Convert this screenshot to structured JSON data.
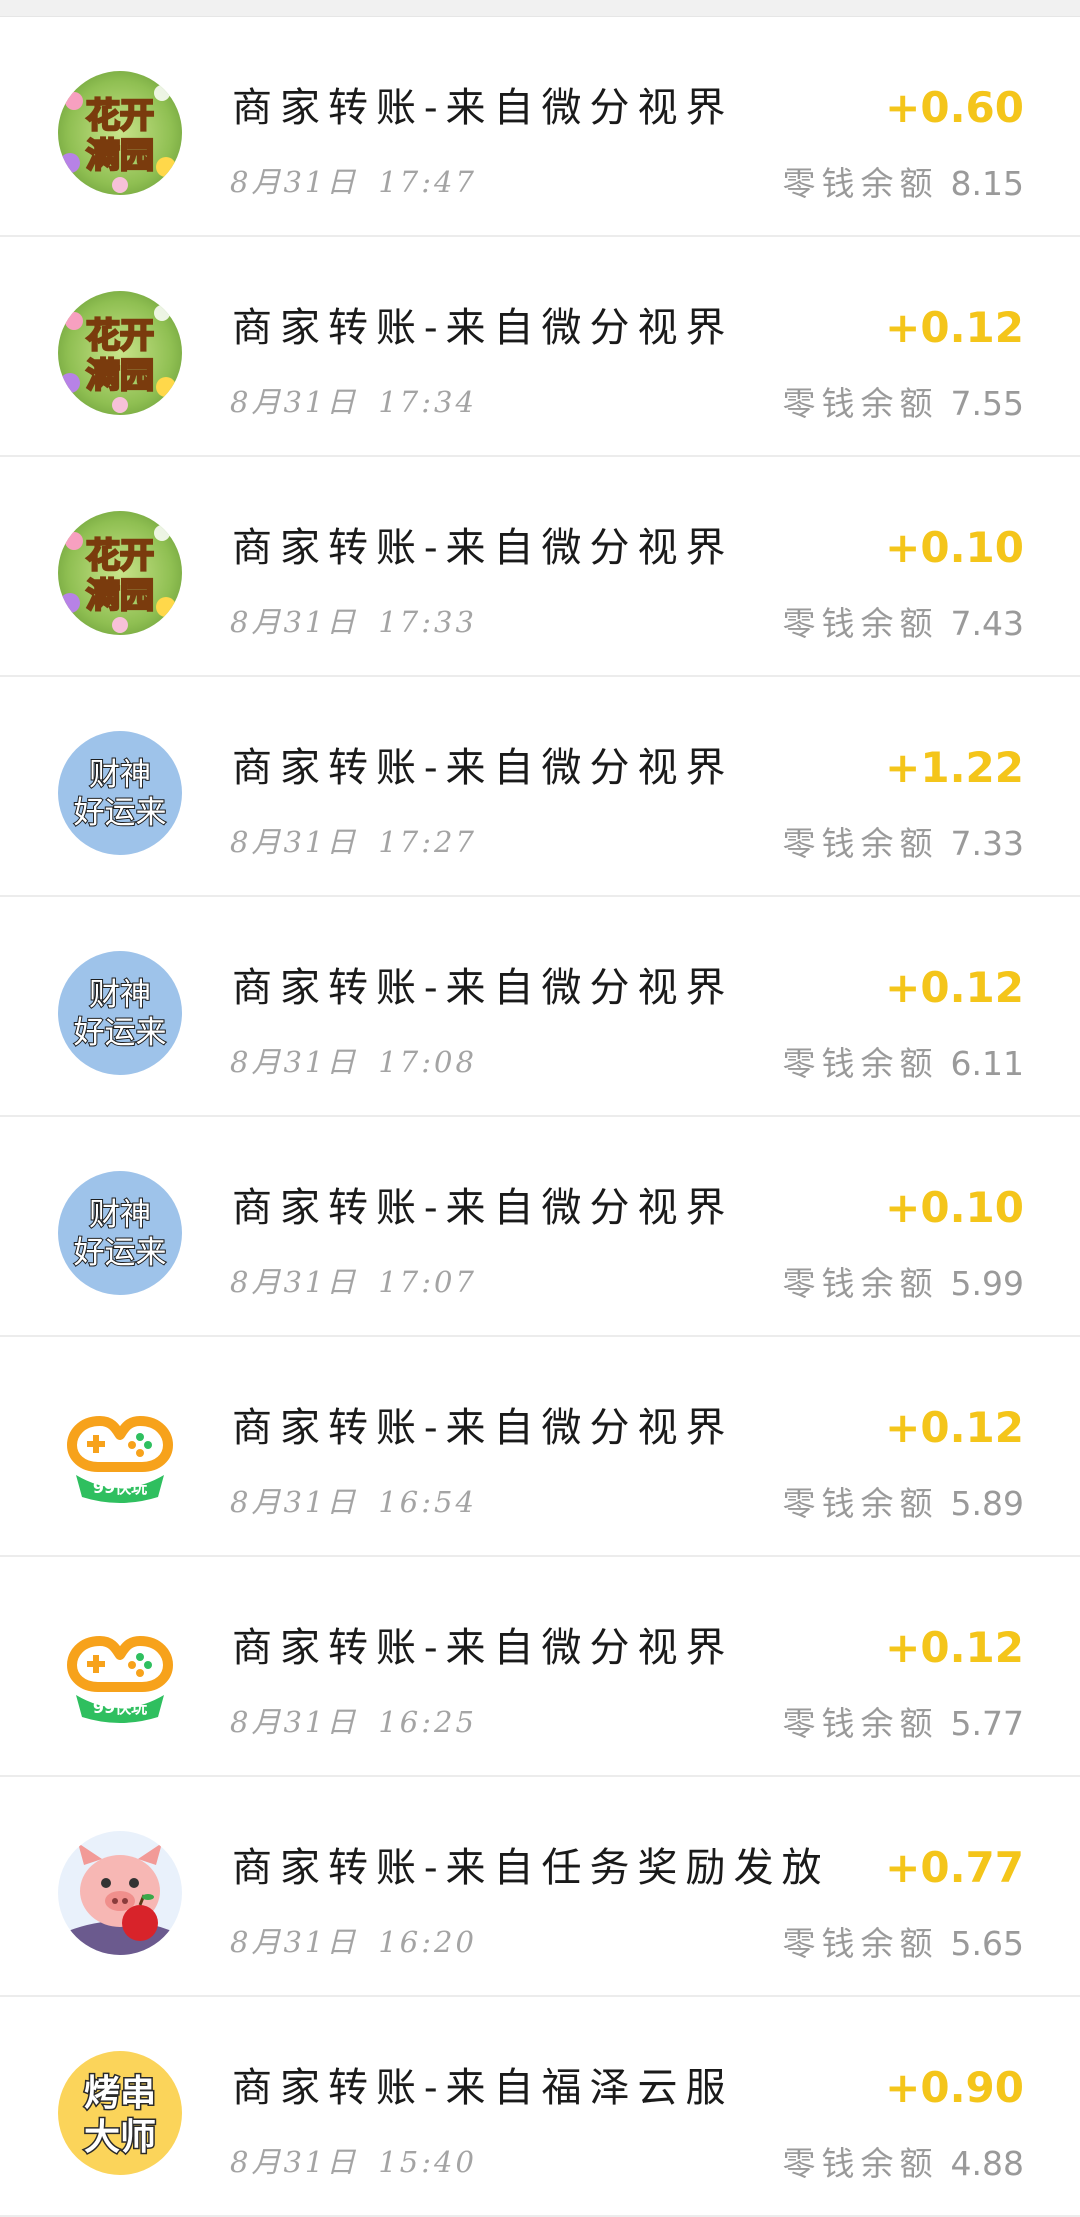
{
  "transactions": [
    {
      "icon": "huakai-manyuan-game-icon",
      "title": "商家转账-来自微分视界",
      "date": "8月31日",
      "time": "17:47",
      "amount": "+0.60",
      "balance_label": "零钱余额",
      "balance": "8.15"
    },
    {
      "icon": "huakai-manyuan-game-icon",
      "title": "商家转账-来自微分视界",
      "date": "8月31日",
      "time": "17:34",
      "amount": "+0.12",
      "balance_label": "零钱余额",
      "balance": "7.55"
    },
    {
      "icon": "huakai-manyuan-game-icon",
      "title": "商家转账-来自微分视界",
      "date": "8月31日",
      "time": "17:33",
      "amount": "+0.10",
      "balance_label": "零钱余额",
      "balance": "7.43"
    },
    {
      "icon": "caishen-haoyunlai-icon",
      "title": "商家转账-来自微分视界",
      "date": "8月31日",
      "time": "17:27",
      "amount": "+1.22",
      "balance_label": "零钱余额",
      "balance": "7.33"
    },
    {
      "icon": "caishen-haoyunlai-icon",
      "title": "商家转账-来自微分视界",
      "date": "8月31日",
      "time": "17:08",
      "amount": "+0.12",
      "balance_label": "零钱余额",
      "balance": "6.11"
    },
    {
      "icon": "caishen-haoyunlai-icon",
      "title": "商家转账-来自微分视界",
      "date": "8月31日",
      "time": "17:07",
      "amount": "+0.10",
      "balance_label": "零钱余额",
      "balance": "5.99"
    },
    {
      "icon": "99-kuaiwan-gamepad-icon",
      "title": "商家转账-来自微分视界",
      "date": "8月31日",
      "time": "16:54",
      "amount": "+0.12",
      "balance_label": "零钱余额",
      "balance": "5.89"
    },
    {
      "icon": "99-kuaiwan-gamepad-icon",
      "title": "商家转账-来自微分视界",
      "date": "8月31日",
      "time": "16:25",
      "amount": "+0.12",
      "balance_label": "零钱余额",
      "balance": "5.77"
    },
    {
      "icon": "pig-apple-icon",
      "title": "商家转账-来自任务奖励发放",
      "date": "8月31日",
      "time": "16:20",
      "amount": "+0.77",
      "balance_label": "零钱余额",
      "balance": "5.65"
    },
    {
      "icon": "kaochuan-dashi-icon",
      "title": "商家转账-来自福泽云服",
      "date": "8月31日",
      "time": "15:40",
      "amount": "+0.90",
      "balance_label": "零钱余额",
      "balance": "4.88"
    }
  ],
  "icon_text": {
    "huakai_line1": "花开",
    "huakai_line2": "满园",
    "caishen_line1": "财神",
    "caishen_line2": "好运来",
    "kuaiwan_label": "99快玩",
    "kaochuan_line1": "烤串",
    "kaochuan_line2": "大师"
  },
  "colors": {
    "amount": "#f4c51a",
    "title": "#1a1a1a",
    "secondary": "#a4a4a4",
    "divider": "#ececec",
    "caishen_bg": "#9ec3ea",
    "kuaiwan_orange": "#f7a21b",
    "kuaiwan_green": "#2fbf5f"
  }
}
